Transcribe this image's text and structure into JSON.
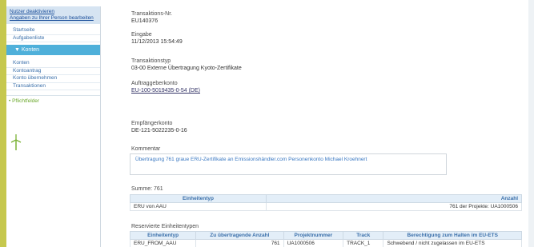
{
  "sidebar": {
    "top_links": [
      "Nutzer deaktivieren",
      "Angaben zu Ihrer Person bearbeiten"
    ],
    "items_a": [
      "Startseite",
      "Aufgabenliste"
    ],
    "section_header": "▼ Konten",
    "items_b": [
      "Konten",
      "Kontoantrag",
      "Konto übernehmen",
      "Transaktionen"
    ],
    "optional_label": "• Pflichtfelder"
  },
  "transaction": {
    "number_label": "Transaktions-Nr.",
    "number_value": "EU140376",
    "receipt_label": "Eingabe",
    "receipt_value": "11/12/2013 15:54:49",
    "type_label": "Transaktionstyp",
    "type_value": "03-00 Externe Übertragung Kyoto-Zertifikate",
    "source_label": "Auftraggeberkonto",
    "source_value": "EU-100-5019435-0-54 (DE)",
    "dest_label": "Empfängerkonto",
    "dest_value": "DE-121-5022235-0-16",
    "comment_label": "Kommentar",
    "comment_value": "Übertragung 761 graue ERU-Zertifikate an Emissionshändler.com Personenkonto Michael Kroehnert"
  },
  "summary": {
    "sum_label": "Summe: 761",
    "headers": [
      "Einheitentyp",
      "Anzahl"
    ],
    "rows": [
      [
        "ERU von AAU",
        "761 der Projekte: UA1000506"
      ]
    ]
  },
  "reserved": {
    "title": "Reservierte Einheitentypen",
    "headers": [
      "Einheitentyp",
      "Zu übertragende Anzahl",
      "Projektnummer",
      "Track",
      "Berechtigung zum Halten im EU-ETS"
    ],
    "rows": [
      [
        "ERU_FROM_AAU",
        "761",
        "UA1000506",
        "TRACK_1",
        "Schwebend / nicht zugelassen im EU-ETS"
      ]
    ]
  }
}
